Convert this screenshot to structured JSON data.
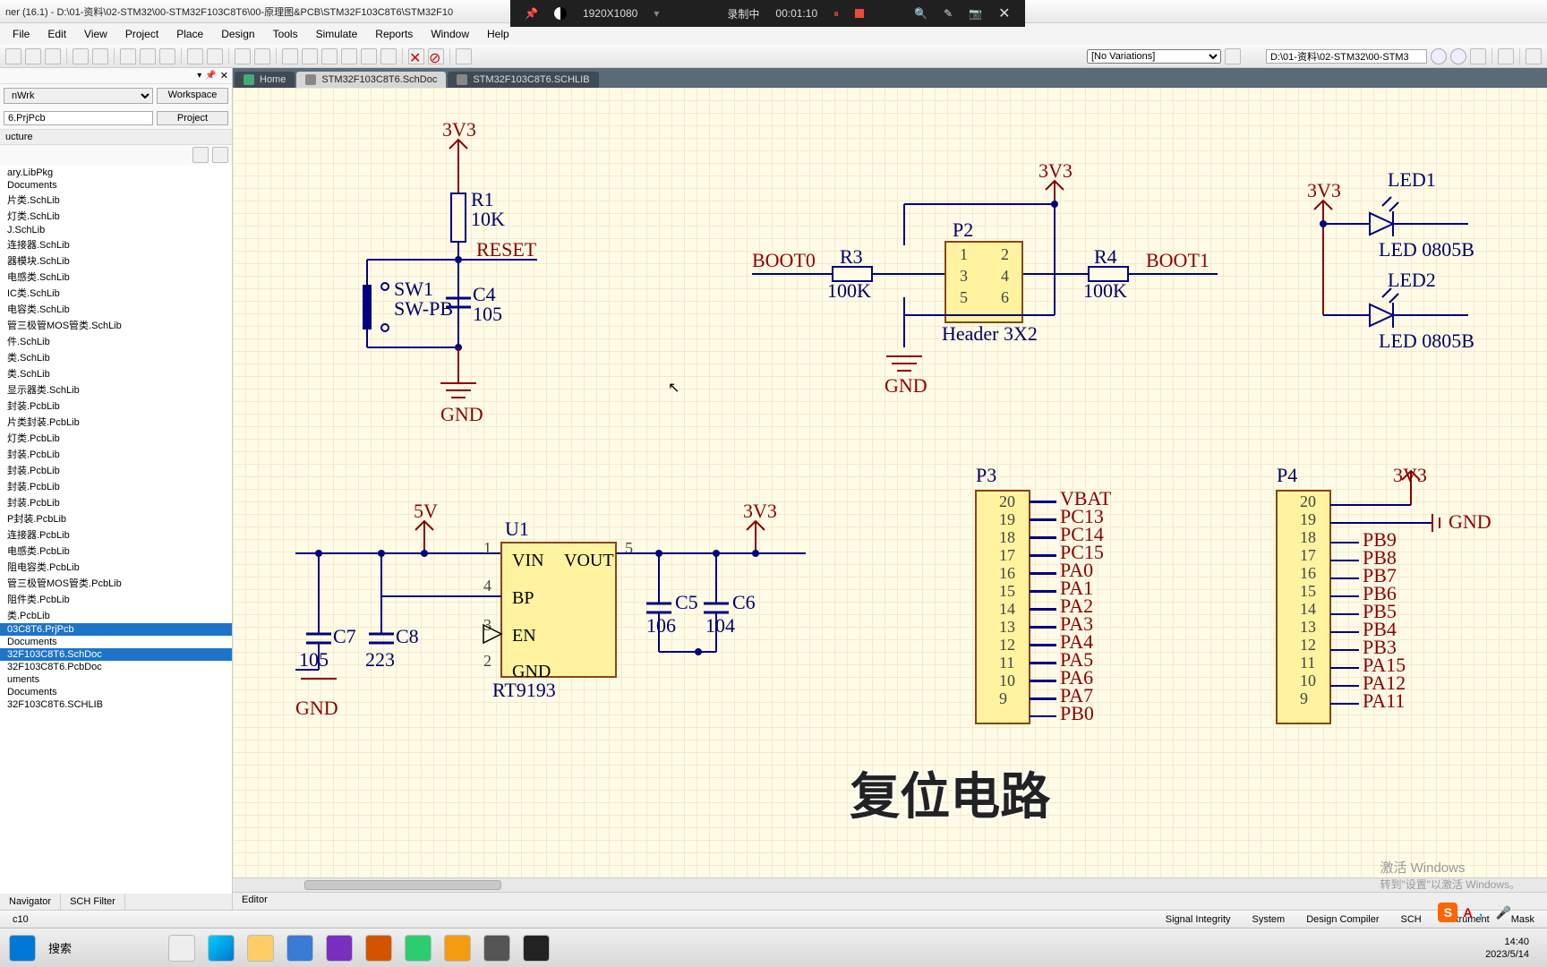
{
  "titlebar": "ner (16.1) - D:\\01-资料\\02-STM32\\00-STM32F103C8T6\\00-原理图&PCB\\STM32F103C8T6\\STM32F10",
  "menus": [
    "File",
    "Edit",
    "View",
    "Project",
    "Place",
    "Design",
    "Tools",
    "Simulate",
    "Reports",
    "Window",
    "Help"
  ],
  "rec": {
    "res": "1920X1080",
    "label": "录制中",
    "time": "00:01:10"
  },
  "path_box": "D:\\01-资料\\02-STM32\\00-STM3",
  "variations": "[No Variations]",
  "side": {
    "combo": "nWrk",
    "workspace": "Workspace",
    "project_val": "6.PrjPcb",
    "project": "Project",
    "structure": "ucture",
    "items": [
      "ary.LibPkg",
      "Documents",
      "片类.SchLib",
      "灯类.SchLib",
      "J.SchLib",
      "连接器.SchLib",
      "器模块.SchLib",
      "电感类.SchLib",
      "IC类.SchLib",
      "电容类.SchLib",
      "管三极管MOS管类.SchLib",
      "件.SchLib",
      "类.SchLib",
      "类.SchLib",
      "显示器类.SchLib",
      "封装.PcbLib",
      "片类封装.PcbLib",
      "灯类.PcbLib",
      "封装.PcbLib",
      "封装.PcbLib",
      "封装.PcbLib",
      "封装.PcbLib",
      "P封装.PcbLib",
      "连接器.PcbLib",
      "电感类.PcbLib",
      "阻电容类.PcbLib",
      "管三极管MOS管类.PcbLib",
      "阻件类.PcbLib",
      "类.PcbLib",
      "03C8T6.PrjPcb",
      "Documents",
      "32F103C8T6.SchDoc",
      "32F103C8T6.PcbDoc",
      "uments",
      "Documents",
      "32F103C8T6.SCHLIB"
    ],
    "tabs": [
      "Navigator",
      "SCH Filter"
    ]
  },
  "doc_tabs": [
    {
      "label": "Home",
      "active": false,
      "home": true
    },
    {
      "label": "STM32F103C8T6.SchDoc",
      "active": true
    },
    {
      "label": "STM32F103C8T6.SCHLIB",
      "active": false
    }
  ],
  "schematic": {
    "reset": {
      "v": "3V3",
      "r": "R1",
      "rv": "10K",
      "net": "RESET",
      "sw": "SW1",
      "swv": "SW-PB",
      "c": "C4",
      "cv": "105",
      "gnd": "GND"
    },
    "boot": {
      "v": "3V3",
      "l": "BOOT0",
      "r": "BOOT1",
      "r3": "R3",
      "r3v": "100K",
      "r4": "R4",
      "r4v": "100K",
      "p": "P2",
      "pv": "Header 3X2",
      "pins": [
        "1",
        "2",
        "3",
        "4",
        "5",
        "6"
      ],
      "gnd": "GND"
    },
    "leds": {
      "v": "3V3",
      "l1": "LED1",
      "l1v": "LED 0805B",
      "l2": "LED2",
      "l2v": "LED 0805B"
    },
    "vreg": {
      "v5": "5V",
      "v3": "3V3",
      "u": "U1",
      "uv": "RT9193",
      "pins": [
        "VIN",
        "VOUT",
        "BP",
        "EN",
        "GND"
      ],
      "pn": [
        "1",
        "5",
        "4",
        "3",
        "2"
      ],
      "c7": "C7",
      "c7v": "105",
      "c8": "C8",
      "c8v": "223",
      "c5": "C5",
      "c5v": "106",
      "c6": "C6",
      "c6v": "104",
      "gnd": "GND"
    },
    "p3": {
      "d": "P3",
      "pins": [
        "20",
        "19",
        "18",
        "17",
        "16",
        "15",
        "14",
        "13",
        "12",
        "11",
        "10",
        "9"
      ],
      "nets": [
        "VBAT",
        "PC13",
        "PC14",
        "PC15",
        "PA0",
        "PA1",
        "PA2",
        "PA3",
        "PA4",
        "PA5",
        "PA6",
        "PA7",
        "PB0"
      ]
    },
    "p4": {
      "d": "P4",
      "v": "3V3",
      "gnd": "GND",
      "pins": [
        "20",
        "19",
        "18",
        "17",
        "16",
        "15",
        "14",
        "13",
        "12",
        "11",
        "10",
        "9"
      ],
      "nets": [
        "PB9",
        "PB8",
        "PB7",
        "PB6",
        "PB5",
        "PB4",
        "PB3",
        "PA15",
        "PA12",
        "PA11"
      ]
    }
  },
  "editor_tab": "Editor",
  "status": {
    "left": "c10",
    "right": [
      "Signal Integrity",
      "System",
      "Design Compiler",
      "SCH",
      "Instrument",
      "Mask"
    ]
  },
  "watermark": {
    "l1": "激活 Windows",
    "l2": "转到\"设置\"以激活 Windows。"
  },
  "overlay": "复位电路",
  "ime": {
    "s": "S",
    "a": "A",
    "mic": "🎤"
  },
  "clock": {
    "t": "14:40",
    "d": "2023/5/14"
  }
}
